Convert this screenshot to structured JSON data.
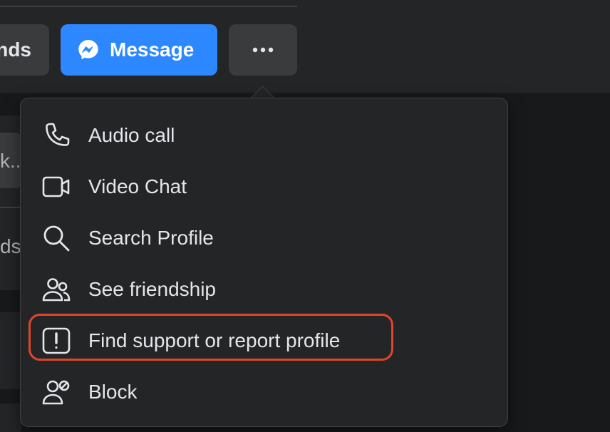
{
  "header": {
    "friends_button_label": "nds",
    "message_button_label": "Message",
    "more_button_label": "•••"
  },
  "background": {
    "search_truncated": "k...",
    "side_text": "ds"
  },
  "menu": {
    "items": [
      {
        "label": "Audio call",
        "icon": "phone-icon"
      },
      {
        "label": "Video Chat",
        "icon": "video-camera-icon"
      },
      {
        "label": "Search Profile",
        "icon": "search-icon"
      },
      {
        "label": "See friendship",
        "icon": "friends-icon"
      },
      {
        "label": "Find support or report profile",
        "icon": "report-icon"
      },
      {
        "label": "Block",
        "icon": "block-user-icon"
      }
    ]
  },
  "colors": {
    "accent": "#2d88ff",
    "highlight": "#e0452b",
    "menu_bg": "#242526",
    "page_bg": "#18191a"
  }
}
